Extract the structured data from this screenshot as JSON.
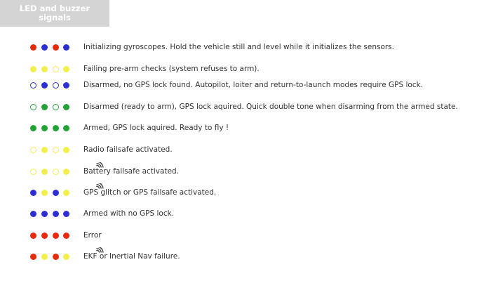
{
  "header": {
    "title_lines": [
      "LED and buzzer",
      "signals"
    ]
  },
  "colors": {
    "red": "#e8290c",
    "blue": "#2e2ed6",
    "yellow": "#f2ef4a",
    "green": "#21a336",
    "title_bg": "#d4d4d4",
    "buzzer": "#444444"
  },
  "signals": [
    {
      "leds": [
        [
          "red",
          "solid"
        ],
        [
          "blue",
          "solid"
        ],
        [
          "red",
          "solid"
        ],
        [
          "blue",
          "solid"
        ]
      ],
      "buzzer": false,
      "text": "Initializing gyroscopes. Hold the vehicle still and level while it initializes the sensors."
    },
    {
      "leds": [
        [
          "yellow",
          "solid"
        ],
        [
          "yellow",
          "solid"
        ],
        [
          "yellow",
          "hollow"
        ],
        [
          "yellow",
          "solid"
        ]
      ],
      "buzzer": false,
      "text": "Failing pre-arm checks (system refuses to arm)."
    },
    {
      "leds": [
        [
          "blue",
          "hollow"
        ],
        [
          "blue",
          "solid"
        ],
        [
          "blue",
          "hollow"
        ],
        [
          "blue",
          "solid"
        ]
      ],
      "buzzer": false,
      "text": "Disarmed, no GPS lock found. Autopilot, loiter and return-to-launch modes require GPS lock."
    },
    {
      "leds": [
        [
          "green",
          "hollow"
        ],
        [
          "green",
          "solid"
        ],
        [
          "green",
          "hollow"
        ],
        [
          "green",
          "solid"
        ]
      ],
      "buzzer": false,
      "text": "Disarmed (ready to arm), GPS lock aquired. Quick double tone when disarming from the armed state."
    },
    {
      "leds": [
        [
          "green",
          "solid"
        ],
        [
          "green",
          "solid"
        ],
        [
          "green",
          "solid"
        ],
        [
          "green",
          "solid"
        ]
      ],
      "buzzer": false,
      "text": "Armed, GPS lock aquired. Ready to fly !"
    },
    {
      "leds": [
        [
          "yellow",
          "hollow"
        ],
        [
          "yellow",
          "solid"
        ],
        [
          "yellow",
          "hollow"
        ],
        [
          "yellow",
          "solid"
        ]
      ],
      "buzzer": false,
      "text": "Radio failsafe activated."
    },
    {
      "leds": [
        [
          "yellow",
          "hollow"
        ],
        [
          "yellow",
          "solid"
        ],
        [
          "yellow",
          "hollow"
        ],
        [
          "yellow",
          "solid"
        ]
      ],
      "buzzer": true,
      "text": "Battery failsafe activated."
    },
    {
      "leds": [
        [
          "blue",
          "solid"
        ],
        [
          "yellow",
          "solid"
        ],
        [
          "blue",
          "solid"
        ],
        [
          "yellow",
          "solid"
        ]
      ],
      "buzzer": true,
      "text": "GPS glitch or GPS failsafe activated."
    },
    {
      "leds": [
        [
          "blue",
          "solid"
        ],
        [
          "blue",
          "solid"
        ],
        [
          "blue",
          "solid"
        ],
        [
          "blue",
          "solid"
        ]
      ],
      "buzzer": false,
      "text": "Armed with no GPS lock."
    },
    {
      "leds": [
        [
          "red",
          "solid"
        ],
        [
          "red",
          "solid"
        ],
        [
          "red",
          "solid"
        ],
        [
          "red",
          "solid"
        ]
      ],
      "buzzer": false,
      "text": "Error"
    },
    {
      "leds": [
        [
          "red",
          "solid"
        ],
        [
          "yellow",
          "solid"
        ],
        [
          "red",
          "solid"
        ],
        [
          "yellow",
          "solid"
        ]
      ],
      "buzzer": true,
      "text": "EKF or Inertial Nav failure."
    }
  ]
}
